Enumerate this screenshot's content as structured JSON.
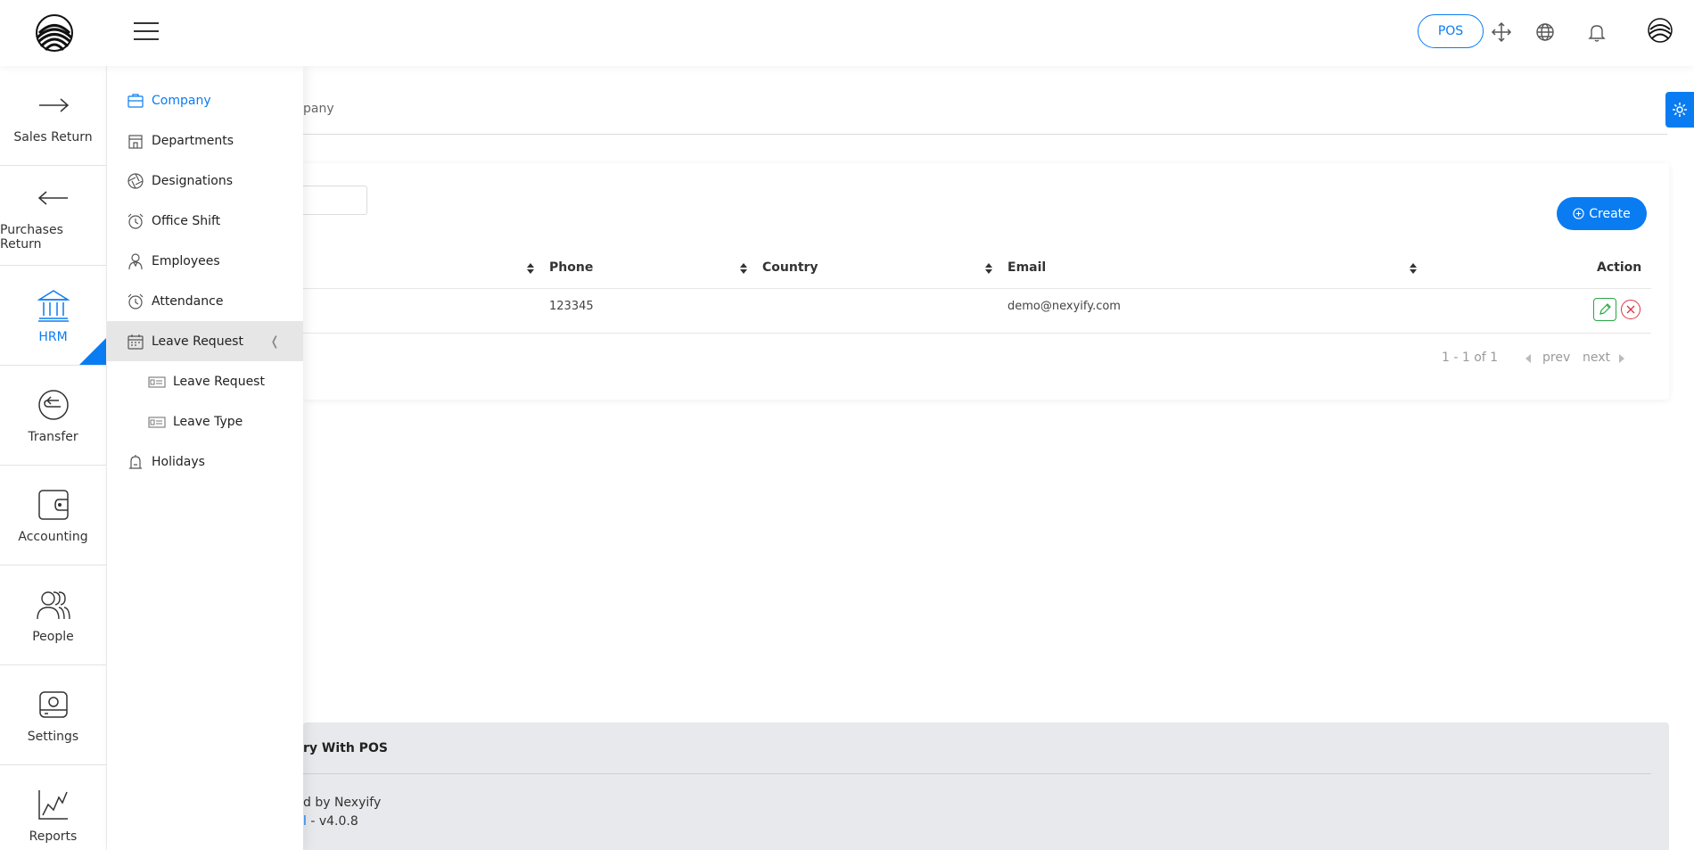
{
  "header": {
    "pos_label": "POS",
    "icons": [
      "fullscreen-icon",
      "globe-icon",
      "bell-icon"
    ]
  },
  "sidebar": {
    "items": [
      {
        "label": "Sales Return",
        "icon": "arrow-right-icon"
      },
      {
        "label": "Purchases Return",
        "icon": "arrow-left-icon"
      },
      {
        "label": "HRM",
        "icon": "bank-icon",
        "active": true
      },
      {
        "label": "Transfer",
        "icon": "transfer-icon"
      },
      {
        "label": "Accounting",
        "icon": "wallet-icon"
      },
      {
        "label": "People",
        "icon": "people-icon"
      },
      {
        "label": "Settings",
        "icon": "settings-icon"
      },
      {
        "label": "Reports",
        "icon": "chart-icon"
      }
    ]
  },
  "submenu": {
    "items": [
      {
        "label": "Company",
        "icon": "briefcase-icon",
        "active": true
      },
      {
        "label": "Departments",
        "icon": "building-icon"
      },
      {
        "label": "Designations",
        "icon": "aperture-icon"
      },
      {
        "label": "Office Shift",
        "icon": "alarm-clock-icon"
      },
      {
        "label": "Employees",
        "icon": "employee-icon"
      },
      {
        "label": "Attendance",
        "icon": "alarm-clock-icon"
      },
      {
        "label": "Leave Request",
        "icon": "calendar-icon",
        "open": true,
        "arrow": "❬"
      },
      {
        "label": "Leave Request",
        "icon": "id-card-icon",
        "child": true
      },
      {
        "label": "Leave Type",
        "icon": "id-card-icon",
        "child": true
      },
      {
        "label": "Holidays",
        "icon": "bell-tower-icon"
      }
    ]
  },
  "breadcrumb": "pany",
  "toolbar": {
    "search_value": "",
    "create_label": "Create"
  },
  "table": {
    "headers": [
      "Phone",
      "Country",
      "Email",
      "Action"
    ],
    "row": {
      "phone": "123345",
      "country": "",
      "email": "demo@nexyify.com"
    }
  },
  "pagination": {
    "range": "1 - 1 of 1",
    "prev": "prev",
    "next": "next"
  },
  "footer": {
    "title": "ry With POS",
    "developer": "d by Nexyify",
    "version_link": "l",
    "version": " - v4.0.8"
  },
  "colors": {
    "accent": "#0a7cf2",
    "edit": "#28a745",
    "delete": "#dc3545"
  }
}
